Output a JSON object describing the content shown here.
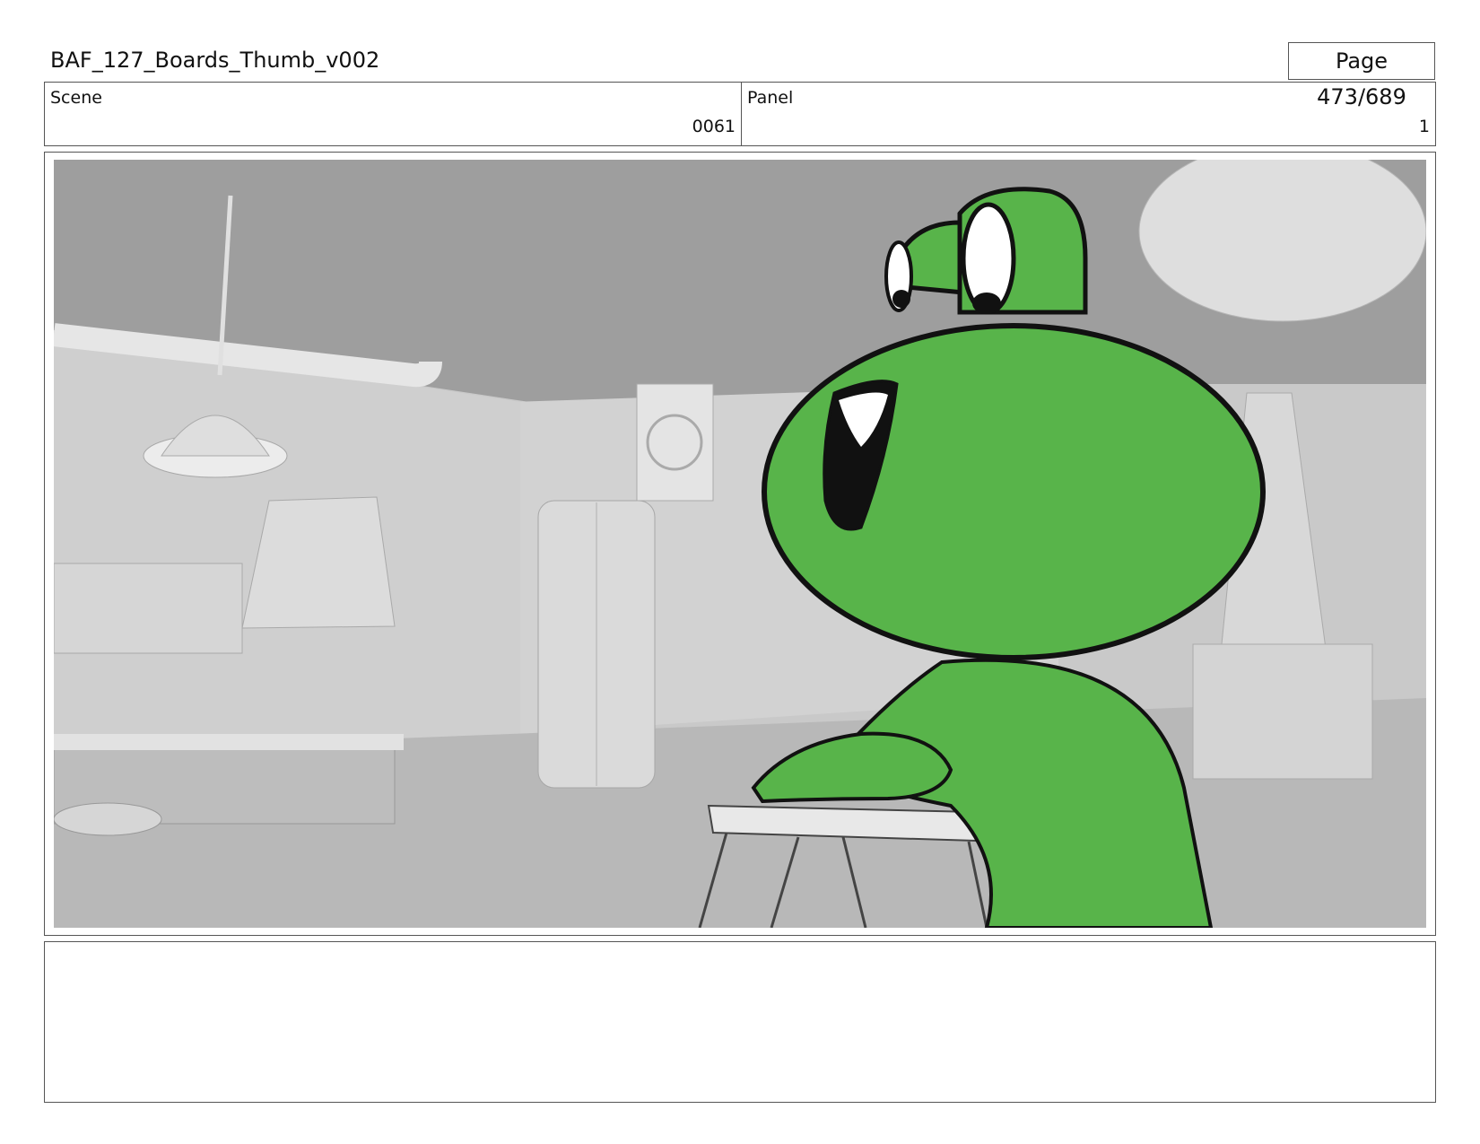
{
  "header": {
    "title": "BAF_127_Boards_Thumb_v002",
    "page": "Page 473/689"
  },
  "info": {
    "scene_label": "Scene",
    "scene_value": "0061",
    "panel_label": "Panel",
    "panel_value": "1"
  },
  "panel_image": {
    "depicts": "green-frog-character-in-kitchen",
    "colors": {
      "frog": "#58b44a",
      "background": "#c8c8c8"
    }
  },
  "notes": {
    "text": ""
  }
}
